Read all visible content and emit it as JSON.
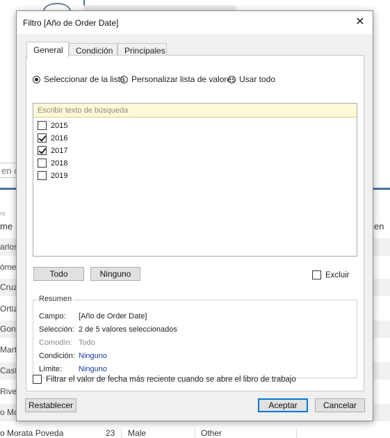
{
  "background": {
    "search_text": "en c",
    "small_label": "rs",
    "column_left": "me",
    "column_right": "en",
    "rows": [
      "arlos",
      "ómez",
      "Cruz",
      "Ortiz",
      "Gon",
      "Marti",
      "Casti",
      "Rive",
      "o Mor"
    ],
    "last_row": {
      "name": "o Morata Poveda",
      "age": "23",
      "gender": "Male",
      "other": "Other"
    }
  },
  "dialog": {
    "title": "Filtro [Año de Order Date]",
    "close_glyph": "✕",
    "tabs": [
      {
        "label": "General",
        "active": true
      },
      {
        "label": "Condición",
        "active": false
      },
      {
        "label": "Principales",
        "active": false
      }
    ],
    "radios": [
      {
        "label": "Seleccionar de la lista",
        "selected": true
      },
      {
        "label": "Personalizar lista de valores",
        "selected": false
      },
      {
        "label": "Usar todo",
        "selected": false
      }
    ],
    "search_placeholder": "Escribir texto de búsqueda",
    "items": [
      {
        "label": "2015",
        "checked": false
      },
      {
        "label": "2016",
        "checked": true
      },
      {
        "label": "2017",
        "checked": true
      },
      {
        "label": "2018",
        "checked": false
      },
      {
        "label": "2019",
        "checked": false
      }
    ],
    "all_button": "Todo",
    "none_button": "Ninguno",
    "exclude_label": "Excluir",
    "exclude_checked": false,
    "summary": {
      "legend": "Resumen",
      "field_key": "Campo:",
      "field_value": "[Año de Order Date]",
      "selection_key": "Selección:",
      "selection_value": "2 de 5 valores seleccionados",
      "wildcard_key": "Comodín:",
      "wildcard_value": "Todo",
      "condition_key": "Condición:",
      "condition_value": "Ninguno",
      "limit_key": "Límite:",
      "limit_value": "Ninguno"
    },
    "recent_label": "Filtrar el valor de fecha más reciente cuando se abre el libro de trabajo",
    "recent_checked": false,
    "reset_button": "Restablecer",
    "ok_button": "Aceptar",
    "cancel_button": "Cancelar"
  },
  "colors": {
    "accent": "#0078d7",
    "link": "#1a3aa8",
    "search_bg": "#fdf9d8"
  }
}
